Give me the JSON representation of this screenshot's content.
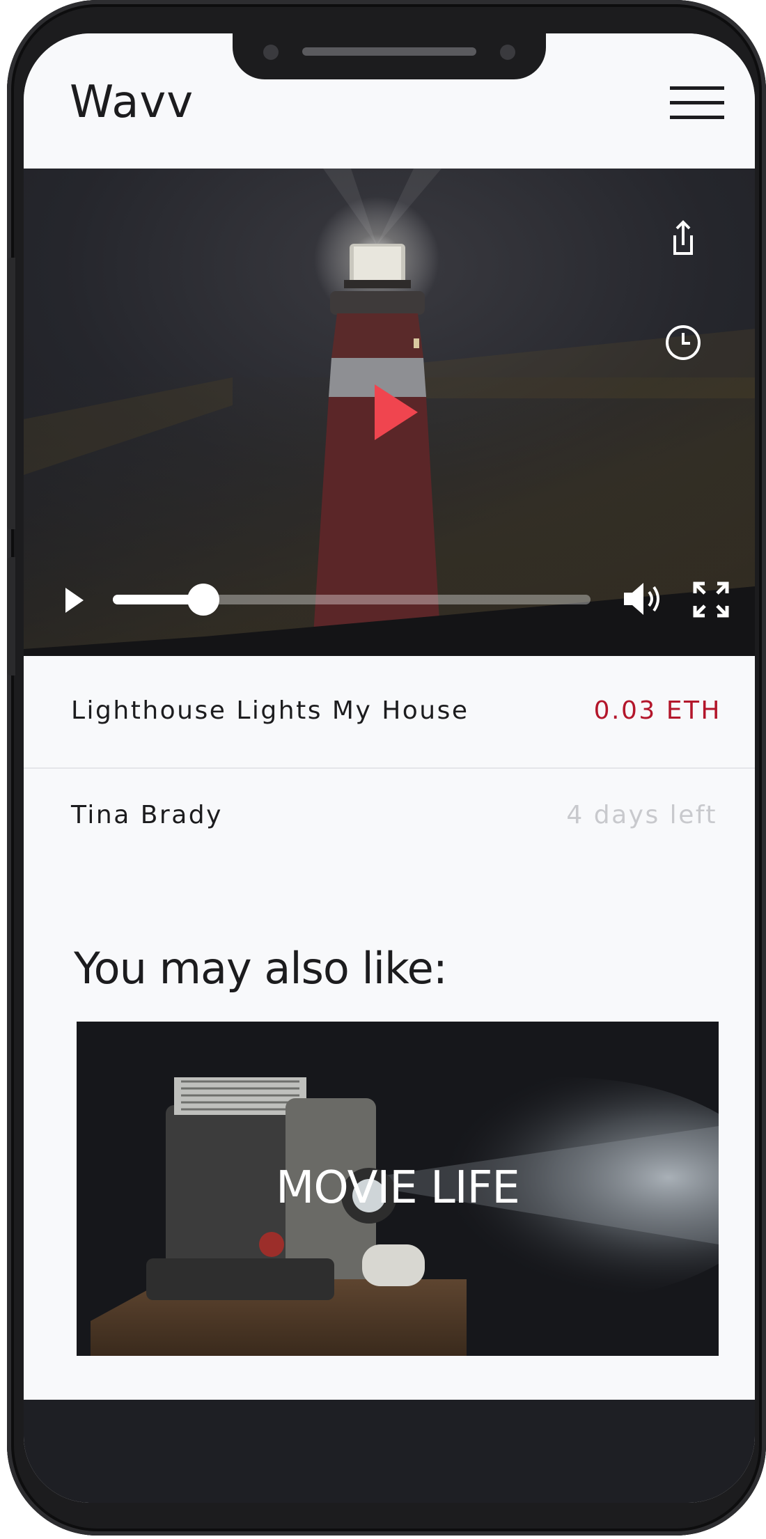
{
  "app": {
    "logo": "Wavv",
    "menu_icon": "hamburger-menu-icon"
  },
  "player": {
    "share_icon": "share-icon",
    "history_icon": "clock-icon",
    "play_icon": "play-icon",
    "volume_icon": "volume-icon",
    "fullscreen_icon": "fullscreen-icon",
    "progress_fraction": 0.19,
    "accent_color": "#f0454f"
  },
  "track": {
    "title": "Lighthouse Lights My House",
    "price": "0.03 ETH",
    "artist": "Tina Brady",
    "time_left": "4 days left"
  },
  "recommendations": {
    "heading": "You may also like:",
    "items": [
      {
        "label": "MOVIE LIFE"
      }
    ]
  },
  "colors": {
    "price": "#b3162b",
    "muted": "#c8c9cd",
    "dark": "#1c1c1e"
  }
}
